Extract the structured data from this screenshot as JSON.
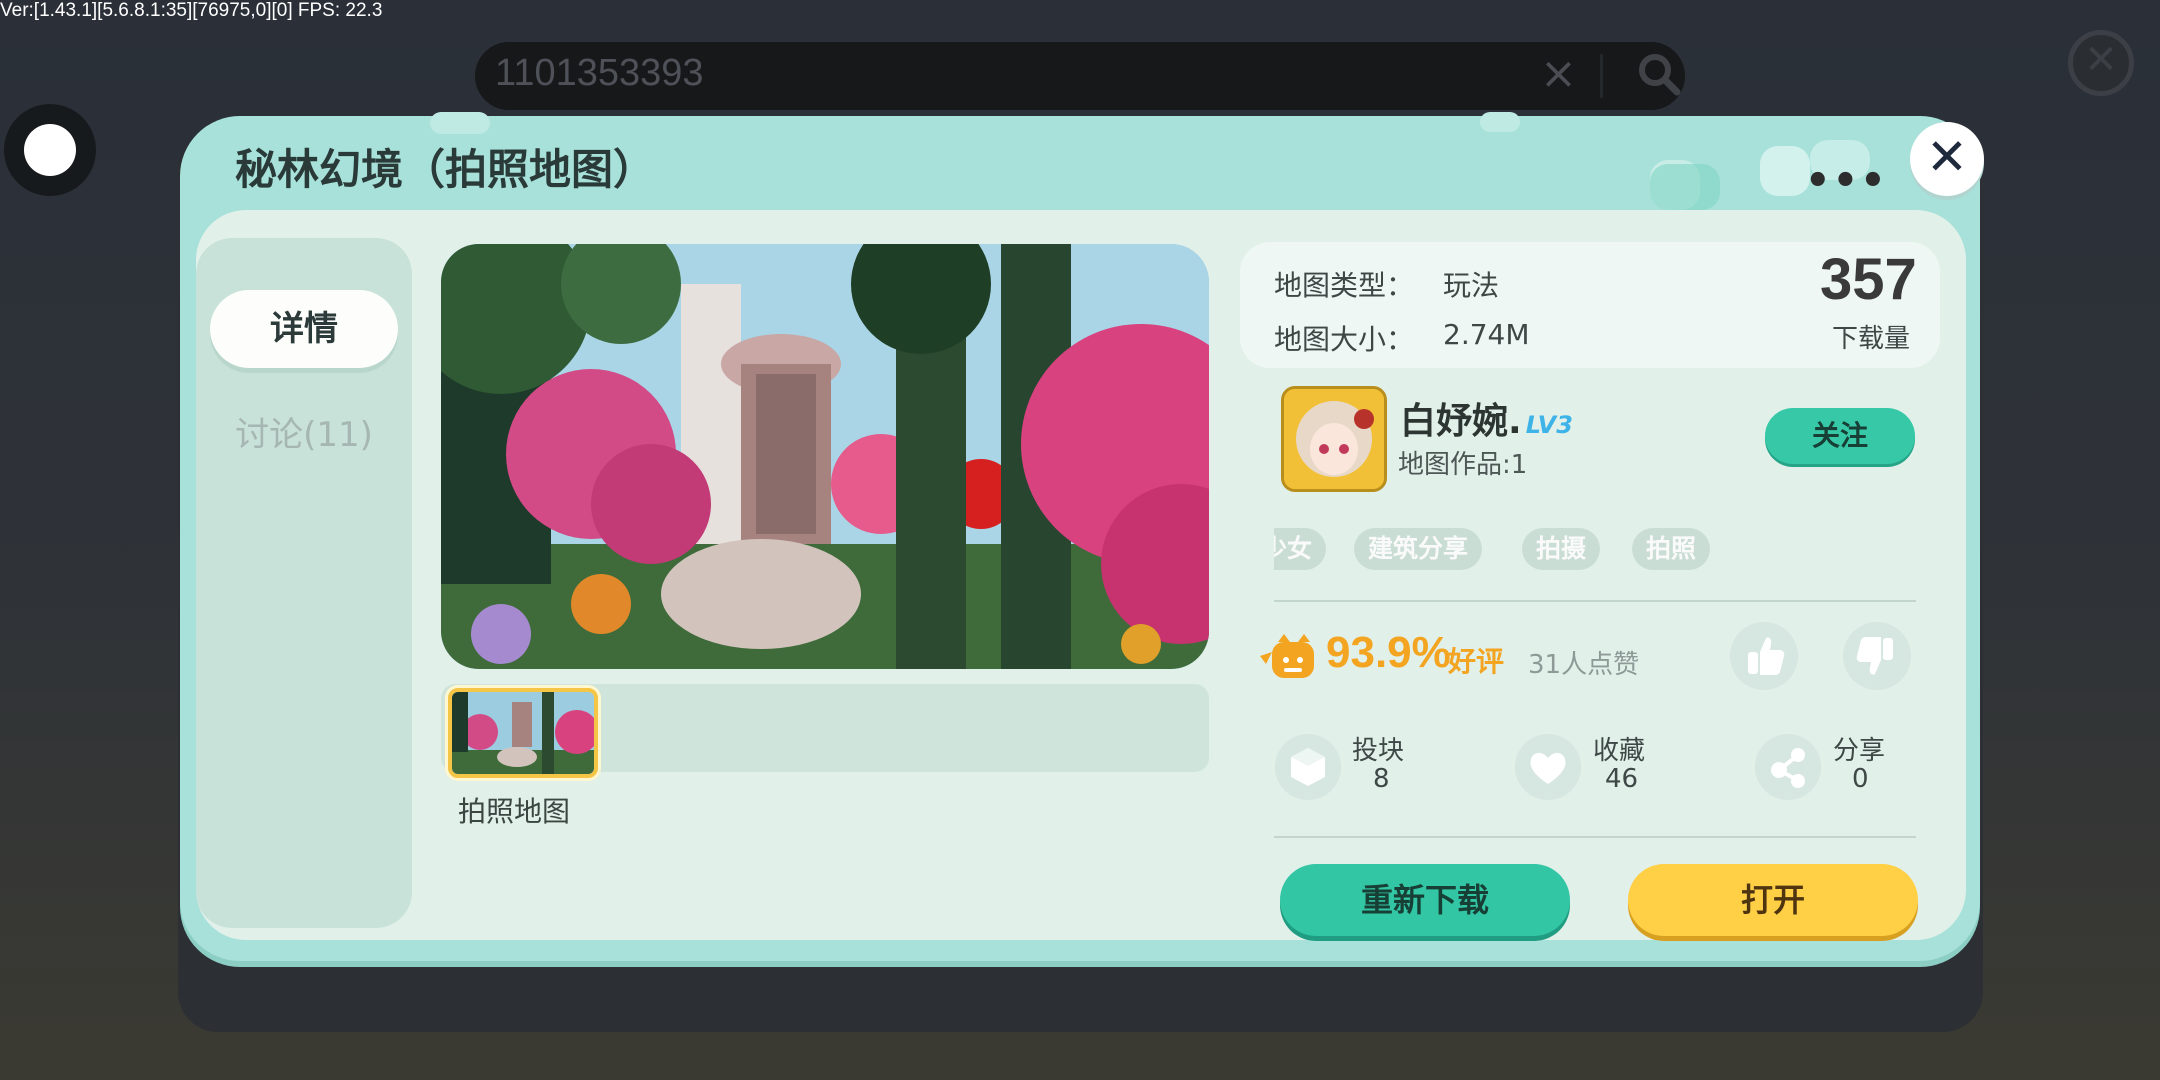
{
  "debug": {
    "text": "Ver:[1.43.1][5.6.8.1:35][76975,0][0] FPS: 22.3"
  },
  "search": {
    "value": "1101353393",
    "clear_icon": "×"
  },
  "dialog": {
    "title": "秘林幻境（拍照地图）",
    "more_icon": "•••",
    "close_icon": "✕"
  },
  "sidebar": {
    "tabs": [
      {
        "label": "详情",
        "active": true
      },
      {
        "label": "讨论(11)",
        "active": false
      }
    ]
  },
  "gallery": {
    "thumb_caption": "拍照地图"
  },
  "info": {
    "type_label": "地图类型：",
    "type_value": "玩法",
    "size_label": "地图大小：",
    "size_value": "2.74M",
    "downloads": "357",
    "downloads_label": "下载量"
  },
  "author": {
    "name": "白妤婉.",
    "level": "LV3",
    "works": "地图作品:1",
    "follow_label": "关注"
  },
  "tags": [
    "少女",
    "建筑分享",
    "拍摄",
    "拍照"
  ],
  "rating": {
    "percent": "93.9%",
    "word": "好评",
    "likes": "31人点赞"
  },
  "stats": [
    {
      "name": "投块",
      "value": "8",
      "icon": "cube-icon"
    },
    {
      "name": "收藏",
      "value": "46",
      "icon": "heart-icon"
    },
    {
      "name": "分享",
      "value": "0",
      "icon": "share-icon"
    }
  ],
  "actions": {
    "redownload": "重新下载",
    "open": "打开"
  },
  "colors": {
    "accent_teal": "#33c6a5",
    "accent_yellow": "#ffcf46",
    "rating_orange": "#f3a420",
    "dialog_header": "#a7e1d9"
  }
}
